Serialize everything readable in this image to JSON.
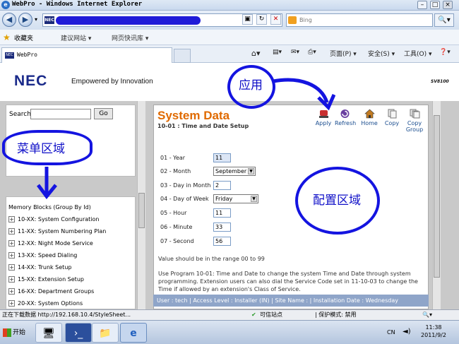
{
  "window": {
    "title": "WebPro - Windows Internet Explorer",
    "tab_label": "WebPro"
  },
  "toolbar": {
    "search_placeholder": "Bing",
    "favorites_label": "收藏夹",
    "fav_items": [
      "建议网站 ▾",
      "网页快讯库 ▾"
    ],
    "commands": [
      "页面(P) ▾",
      "安全(S) ▾",
      "工具(O) ▾"
    ]
  },
  "header": {
    "logo": "NEC",
    "tagline": "Empowered by Innovation",
    "model": "SV8100"
  },
  "search_panel": {
    "label": "Search",
    "go_label": "Go"
  },
  "memory_blocks": {
    "title": "Memory Blocks (Group By Id)",
    "items": [
      "10-XX: System Configuration",
      "11-XX: System Numbering Plan",
      "12-XX: Night Mode Service",
      "13-XX: Speed Dialing",
      "14-XX: Trunk Setup",
      "15-XX: Extension Setup",
      "16-XX: Department Groups",
      "20-XX: System Options"
    ]
  },
  "content": {
    "title": "System Data",
    "subtitle": "10-01 : Time and Date Setup",
    "tools": [
      "Apply",
      "Refresh",
      "Home",
      "Copy",
      "Copy Group"
    ],
    "fields": [
      {
        "label": "01 - Year",
        "value": "11"
      },
      {
        "label": "02 - Month",
        "value": "September"
      },
      {
        "label": "03 - Day in Month",
        "value": "2"
      },
      {
        "label": "04 - Day of Week",
        "value": "Friday"
      },
      {
        "label": "05 - Hour",
        "value": "11"
      },
      {
        "label": "06 - Minute",
        "value": "33"
      },
      {
        "label": "07 - Second",
        "value": "56"
      }
    ],
    "range_note": "Value should be in the range 00 to 99",
    "help": "Use Program 10-01: Time and Date to change the system Time and Date through system programming. Extension users can also dial the Service Code set in 11-10-03 to change the Time if allowed by an extension's Class of Service.",
    "status": "User : tech | Access Level : Installer (IN) | Site Name : | Installation Date : Wednesday"
  },
  "ie_status": {
    "loading": "正在下载数据 http://192.168.10.4/StyleSheet...",
    "zone": "可信站点",
    "protected": "| 保护模式: 禁用"
  },
  "taskbar": {
    "start": "开始",
    "tray_lang": "CN",
    "time": "11:38",
    "date": "2011/9/2"
  },
  "annotations": {
    "apply_note": "应用",
    "menu_note": "菜单区域",
    "config_note": "配置区域",
    "ink_color": "#1414e0"
  }
}
